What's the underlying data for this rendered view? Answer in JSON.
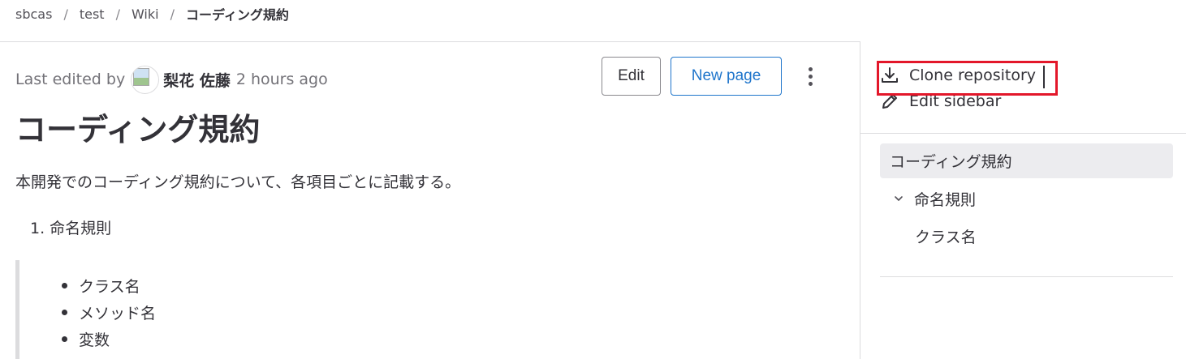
{
  "breadcrumb": {
    "items": [
      "sbcas",
      "test",
      "Wiki"
    ],
    "separator": "/",
    "current": "コーディング規約"
  },
  "page": {
    "last_edited_prefix": "Last edited by",
    "author": "梨花 佐藤",
    "time_ago": "2 hours ago",
    "title": "コーディング規約",
    "intro": "本開発でのコーディング規約について、各項目ごとに記載する。",
    "ordered_item": "1. 命名規則",
    "bullets": [
      "クラス名",
      "メソッド名",
      "変数"
    ]
  },
  "actions": {
    "edit_label": "Edit",
    "new_page_label": "New page"
  },
  "sidebar": {
    "clone_label": "Clone repository",
    "edit_sidebar_label": "Edit sidebar",
    "nav": {
      "active": "コーディング規約",
      "section": "命名規則",
      "child": "クラス名"
    }
  },
  "colors": {
    "accent": "#1f75cb",
    "highlight_box": "#e3172a",
    "text": "#333238",
    "muted": "#737278"
  }
}
